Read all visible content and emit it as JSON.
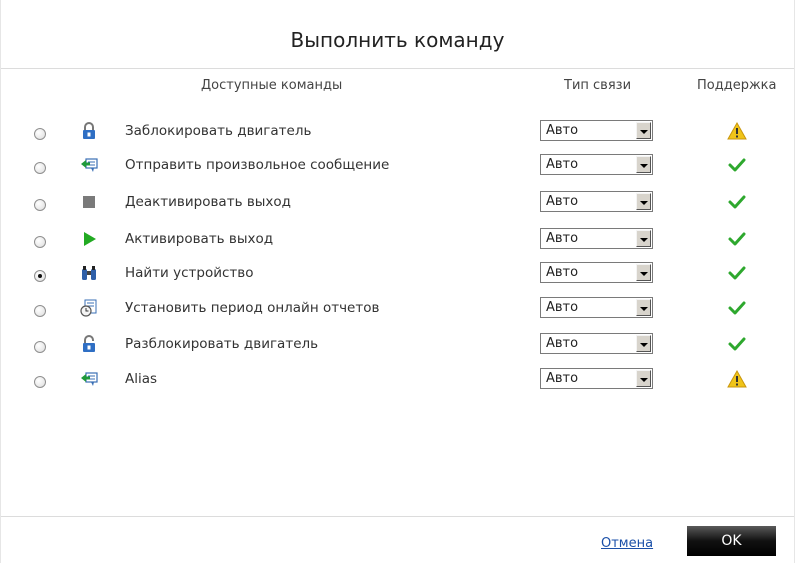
{
  "dialog": {
    "title": "Выполнить команду",
    "columns": {
      "commands": "Доступные команды",
      "type": "Тип связи",
      "support": "Поддержка"
    },
    "commands": [
      {
        "label": "Заблокировать двигатель",
        "icon": "lock-icon",
        "selected": false,
        "type": "Авто",
        "support": "warning-icon"
      },
      {
        "label": "Отправить произвольное сообщение",
        "icon": "send-message-icon",
        "selected": false,
        "type": "Авто",
        "support": "check-icon"
      },
      {
        "label": "Деактивировать выход",
        "icon": "stop-icon",
        "selected": false,
        "type": "Авто",
        "support": "check-icon"
      },
      {
        "label": "Активировать выход",
        "icon": "play-icon",
        "selected": false,
        "type": "Авто",
        "support": "check-icon"
      },
      {
        "label": "Найти устройство",
        "icon": "binoculars-icon",
        "selected": true,
        "type": "Авто",
        "support": "check-icon"
      },
      {
        "label": "Установить период онлайн отчетов",
        "icon": "report-clock-icon",
        "selected": false,
        "type": "Авто",
        "support": "check-icon"
      },
      {
        "label": "Разблокировать двигатель",
        "icon": "unlock-icon",
        "selected": false,
        "type": "Авто",
        "support": "check-icon"
      },
      {
        "label": "Alias",
        "icon": "send-message-icon",
        "selected": false,
        "type": "Авто",
        "support": "warning-icon"
      }
    ],
    "buttons": {
      "cancel": "Отмена",
      "ok": "OK"
    },
    "colors": {
      "check": "#2ea82e",
      "warning": "#f0c419",
      "play": "#22aa22",
      "stop": "#7a7a7a"
    }
  }
}
